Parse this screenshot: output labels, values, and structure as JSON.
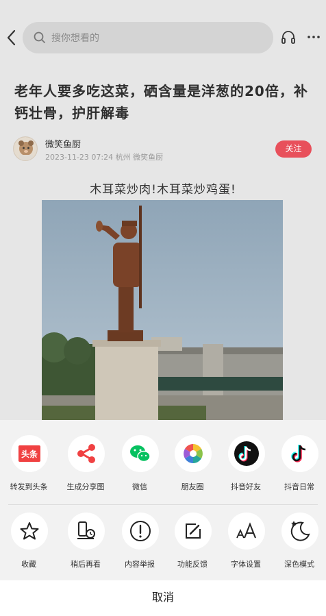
{
  "header": {
    "search_placeholder": "搜你想看的"
  },
  "article": {
    "title": "老年人要多吃这菜，硒含量是洋葱的20倍，补钙壮骨，护肝解毒",
    "author": "微笑鱼厨",
    "meta": "2023-11-23 07:24 杭州 微笑鱼厨",
    "follow_label": "关注",
    "subtitle": "木耳菜炒肉!木耳菜炒鸡蛋!"
  },
  "share_row": [
    {
      "label": "转发到头条",
      "icon": "toutiao-icon"
    },
    {
      "label": "生成分享图",
      "icon": "share-icon"
    },
    {
      "label": "微信",
      "icon": "wechat-icon"
    },
    {
      "label": "朋友圈",
      "icon": "moments-icon"
    },
    {
      "label": "抖音好友",
      "icon": "douyin-friend-icon"
    },
    {
      "label": "抖音日常",
      "icon": "douyin-daily-icon"
    }
  ],
  "action_row": [
    {
      "label": "收藏",
      "icon": "star-icon"
    },
    {
      "label": "稍后再看",
      "icon": "watch-later-icon"
    },
    {
      "label": "内容举报",
      "icon": "report-icon"
    },
    {
      "label": "功能反馈",
      "icon": "feedback-icon"
    },
    {
      "label": "字体设置",
      "icon": "font-size-icon"
    },
    {
      "label": "深色模式",
      "icon": "dark-mode-icon"
    }
  ],
  "toutiao_badge": "头条",
  "cancel_label": "取消",
  "colors": {
    "follow": "#e8505b",
    "toutiao": "#f04142",
    "share": "#f04142",
    "wechat": "#07c160"
  }
}
